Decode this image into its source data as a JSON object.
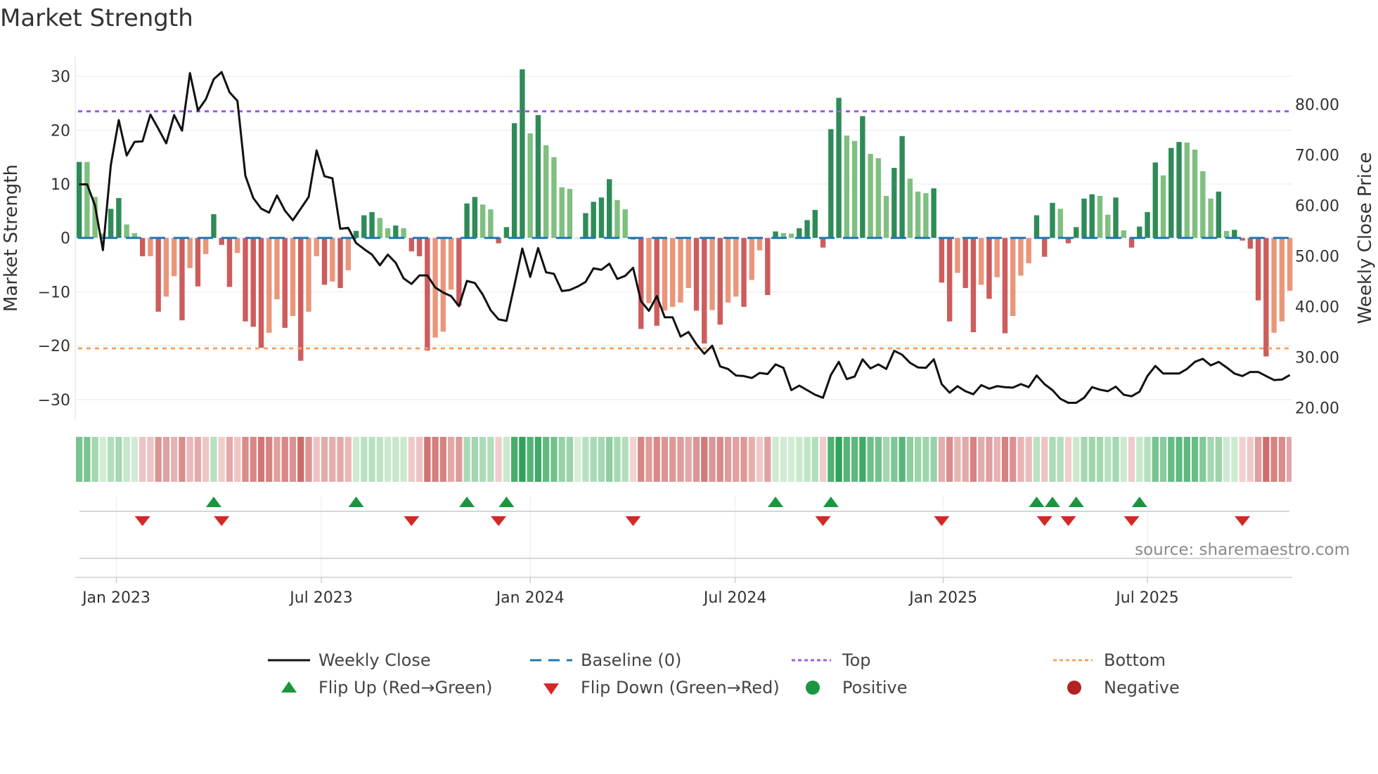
{
  "chart_data": {
    "type": "bar+line",
    "title": "Market Strength",
    "ylabel": "Market Strength",
    "y2label": "Weekly Close Price",
    "ylim": [
      -33.8,
      33.6
    ],
    "y2lim": [
      17.6,
      89.4
    ],
    "xlim": [
      -0.5,
      153.3
    ],
    "yticks": [
      30,
      20,
      10,
      0,
      -10,
      -20,
      -30
    ],
    "yticklabels": [
      "30",
      "20",
      "10",
      "0",
      "−10",
      "−20",
      "−30"
    ],
    "y2ticks": [
      80,
      70,
      60,
      50,
      40,
      30,
      20
    ],
    "y2ticklabels": [
      "80.00",
      "70.00",
      "60.00",
      "50.00",
      "40.00",
      "30.00",
      "20.00"
    ],
    "xticks": [
      4.7,
      30.6,
      57.0,
      82.9,
      109.2,
      135.0
    ],
    "xticklabels": [
      "Jan 2023",
      "Jul 2023",
      "Jan 2024",
      "Jul 2024",
      "Jan 2025",
      "Jul 2025"
    ],
    "x_unit": "week index",
    "top": 23.5,
    "bottom": -20.5,
    "baseline": 0,
    "strength": [
      14.1,
      14.1,
      7.6,
      0.8,
      5.4,
      7.4,
      2.5,
      0.9,
      -3.4,
      -3.4,
      -13.7,
      -10.9,
      -7.1,
      -15.3,
      -5.6,
      -9,
      -3,
      4.4,
      -1.3,
      -9.1,
      -2.8,
      -15.5,
      -16.5,
      -20.4,
      -17.6,
      -11.4,
      -16.7,
      -14.5,
      -22.8,
      -13.7,
      -3.4,
      -8.7,
      -8.1,
      -9.3,
      -6,
      1.3,
      4.2,
      4.8,
      3.7,
      1.8,
      2.3,
      1.8,
      -2.5,
      -3.4,
      -20.9,
      -18.5,
      -17.4,
      -9.6,
      -12.6,
      6.4,
      7.6,
      6.2,
      5.3,
      -1,
      2,
      21.3,
      31.3,
      19.4,
      22.8,
      17.2,
      15,
      9.4,
      9.1,
      0,
      4.6,
      6.7,
      7.5,
      10.9,
      7,
      5.3,
      -0.3,
      -16.9,
      -12.1,
      -16.3,
      -13.5,
      -12.8,
      -12,
      -9.3,
      -13.5,
      -19.6,
      -13.4,
      -16.1,
      -12,
      -10.9,
      -12.8,
      -7.8,
      -2.3,
      -10.6,
      1.2,
      0.9,
      0.8,
      1.8,
      3.3,
      5.2,
      -1.8,
      20.2,
      26,
      19,
      18,
      22.6,
      15.6,
      14.8,
      7.8,
      13,
      18.9,
      11,
      8.6,
      8.3,
      9.2,
      -8.3,
      -15.5,
      -6.5,
      -9.3,
      -17.5,
      -8.7,
      -11.3,
      -7.3,
      -17.7,
      -14.5,
      -7,
      -4.7,
      4.2,
      -3.5,
      6.5,
      5.4,
      -1,
      2,
      7.3,
      8.1,
      7.8,
      4.3,
      7.5,
      1.4,
      -1.8,
      2.1,
      4.8,
      14,
      11.6,
      16.7,
      17.8,
      17.7,
      16.4,
      12.4,
      7.3,
      8.6,
      1.3,
      1.5,
      -0.5,
      -2,
      -11.6,
      -22,
      -17.6,
      -15.5,
      -9.8
    ],
    "close": [
      64.2,
      64.2,
      60,
      51.2,
      68,
      76.9,
      69.9,
      72.6,
      72.7,
      78,
      75.2,
      72.3,
      77.9,
      74.8,
      86.2,
      78.8,
      81,
      85,
      86.4,
      82.4,
      80.7,
      65.9,
      61.5,
      59.4,
      58.6,
      62,
      59,
      57.1,
      59.4,
      61.7,
      70.9,
      65.8,
      65.4,
      55.4,
      55.6,
      52.6,
      51.4,
      50.3,
      48.2,
      50.3,
      48.7,
      45.6,
      44.5,
      46.2,
      46.2,
      43.8,
      42.8,
      42.1,
      40.1,
      45.1,
      44.7,
      42.4,
      39.3,
      37.5,
      37.2,
      44.2,
      51.5,
      45.9,
      51.6,
      46.8,
      46.5,
      43.1,
      43.3,
      44,
      44.9,
      47.6,
      47.3,
      48.5,
      45.5,
      46.1,
      47.7,
      41.1,
      39.2,
      42.1,
      37.9,
      37.9,
      34.1,
      35,
      32.6,
      30.7,
      32.3,
      28.2,
      27.7,
      26.4,
      26.3,
      25.9,
      26.9,
      26.7,
      28.6,
      27.9,
      23.5,
      24.4,
      23.5,
      22.6,
      22,
      26.5,
      29.1,
      25.7,
      26.2,
      29.6,
      27.8,
      28.6,
      27.7,
      31.3,
      30.5,
      28.9,
      28,
      27.9,
      29.6,
      24.7,
      23,
      24.3,
      23.3,
      22.7,
      24.5,
      23.8,
      24.3,
      24.1,
      24,
      24.7,
      24.1,
      26.4,
      24.7,
      23.5,
      21.8,
      21,
      21,
      22,
      24.1,
      23.6,
      23.3,
      24.2,
      22.6,
      22.3,
      23.2,
      26.3,
      28.3,
      26.8,
      26.8,
      26.8,
      27.7,
      29.1,
      29.7,
      28.4,
      29.1,
      28,
      26.8,
      26.3,
      27.1,
      27.1,
      26.3,
      25.5,
      25.6,
      26.5
    ],
    "flip_up": [
      17,
      35,
      49,
      54,
      88,
      95,
      121,
      123,
      126,
      134
    ],
    "flip_down": [
      8,
      18,
      42,
      53,
      70,
      94,
      109,
      122,
      125,
      133,
      147
    ],
    "legend": {
      "placement": "bottom",
      "items": [
        {
          "label": "Weekly Close",
          "symbol": "line-solid"
        },
        {
          "label": "Baseline (0)",
          "symbol": "line-dashed"
        },
        {
          "label": "Top",
          "symbol": "line-dotted"
        },
        {
          "label": "Bottom",
          "symbol": "line-dotted"
        },
        {
          "label": "Flip Up (Red→Green)",
          "symbol": "triangle-up"
        },
        {
          "label": "Flip Down (Green→Red)",
          "symbol": "triangle-down"
        },
        {
          "label": "Positive",
          "symbol": "circle"
        },
        {
          "label": "Negative",
          "symbol": "circle"
        }
      ]
    },
    "colors": {
      "pos_strong": "#2e8b57",
      "pos_weak": "#7fbf7f",
      "neg_strong": "#cd5c5c",
      "neg_weak": "#e9967a",
      "close": "#111111",
      "baseline": "#1f77b4",
      "top": "#9b5de5",
      "bottom": "#f4a460",
      "flip_up": "#1a9641",
      "flip_down": "#d62728",
      "positive": "#1a9641",
      "negative": "#b22222"
    },
    "source": "source: sharemaestro.com"
  }
}
